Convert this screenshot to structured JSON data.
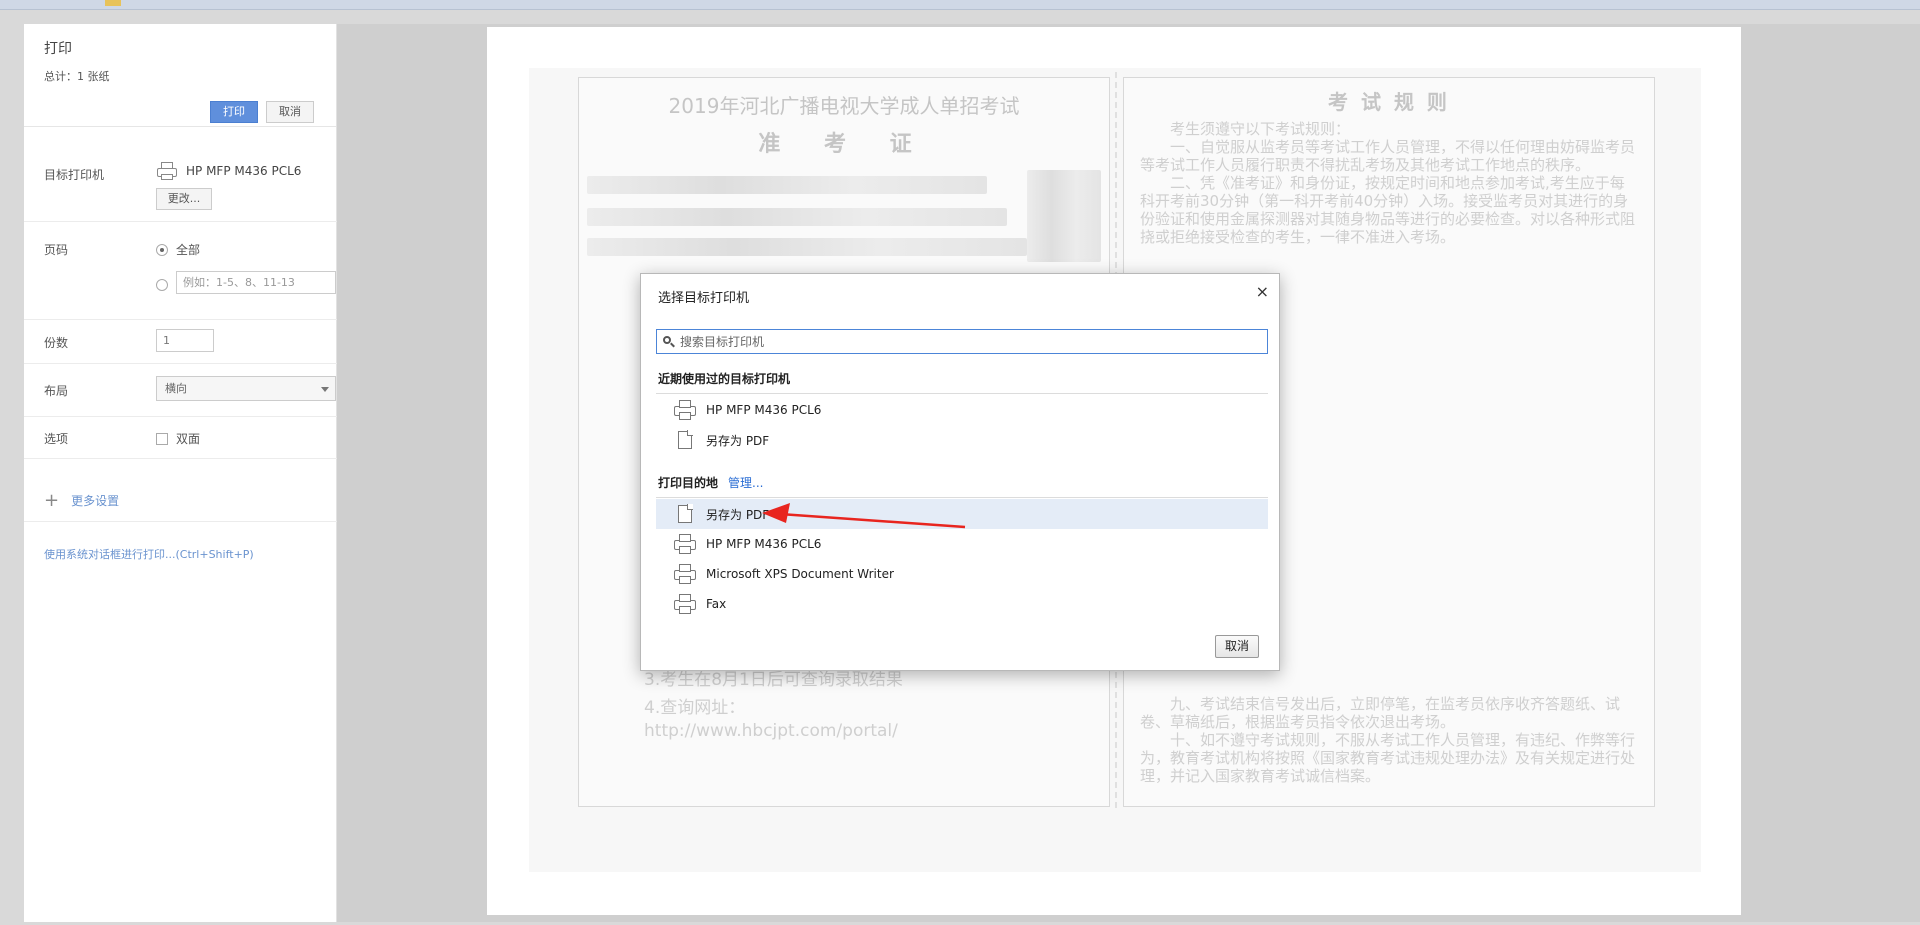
{
  "panel": {
    "title": "打印",
    "total": "总计：1 张纸",
    "print_label": "打印",
    "cancel_label": "取消",
    "destination_label": "目标打印机",
    "destination_value": "HP MFP M436 PCL6",
    "change_label": "更改...",
    "pages_label": "页码",
    "pages_all": "全部",
    "pages_placeholder": "例如：1-5、8、11-13",
    "copies_label": "份数",
    "copies_value": "1",
    "layout_label": "布局",
    "layout_value": "横向",
    "options_label": "选项",
    "options_duplex": "双面",
    "more_settings": "更多设置",
    "system_dialog": "使用系统对话框进行打印...(Ctrl+Shift+P)"
  },
  "document": {
    "title": "2019年河北广播电视大学成人单招考试",
    "subtitle": "准 考 证",
    "rules_title": "考 试 规 则",
    "rules": [
      "考生须遵守以下考试规则：",
      "一、自觉服从监考员等考试工作人员管理，不得以任何理由妨碍监考员等考试工作人员履行职责不得扰乱考场及其他考试工作地点的秩序。",
      "二、凭《准考证》和身份证，按规定时间和地点参加考试,考生应于每科开考前30分钟（第一科开考前40分钟）入场。接受监考员对其进行的身份验证和使用金属探测器对其随身物品等进行的必要检查。对以各种形式阻挠或拒绝接受检查的考生，一律不准进入考场。"
    ],
    "note_lines": [
      "3.考生在8月1日后可查询录取结果",
      "4.查询网址：",
      "http://www.hbcjpt.com/portal/"
    ],
    "rules_bottom": [
      "九、考试结束信号发出后，立即停笔，在监考员依序收齐答题纸、试卷、草稿纸后，根据监考员指令依次退出考场。",
      "十、如不遵守考试规则，不服从考试工作人员管理，有违纪、作弊等行为，教育考试机构将按照《国家教育考试违规处理办法》及有关规定进行处理，并记入国家教育考试诚信档案。"
    ]
  },
  "dialog": {
    "title": "选择目标打印机",
    "close": "×",
    "search_placeholder": "搜索目标打印机",
    "recent_header": "近期使用过的目标打印机",
    "recent": [
      "HP MFP M436 PCL6",
      "另存为 PDF"
    ],
    "dest_header": "打印目的地",
    "manage": "管理...",
    "destinations": [
      "另存为 PDF",
      "HP MFP M436 PCL6",
      "Microsoft XPS Document Writer",
      "Fax"
    ],
    "cancel": "取消"
  },
  "colors": {
    "accent": "#4c85d8",
    "selected_row": "#e4ecf7",
    "arrow": "#e8251f"
  }
}
